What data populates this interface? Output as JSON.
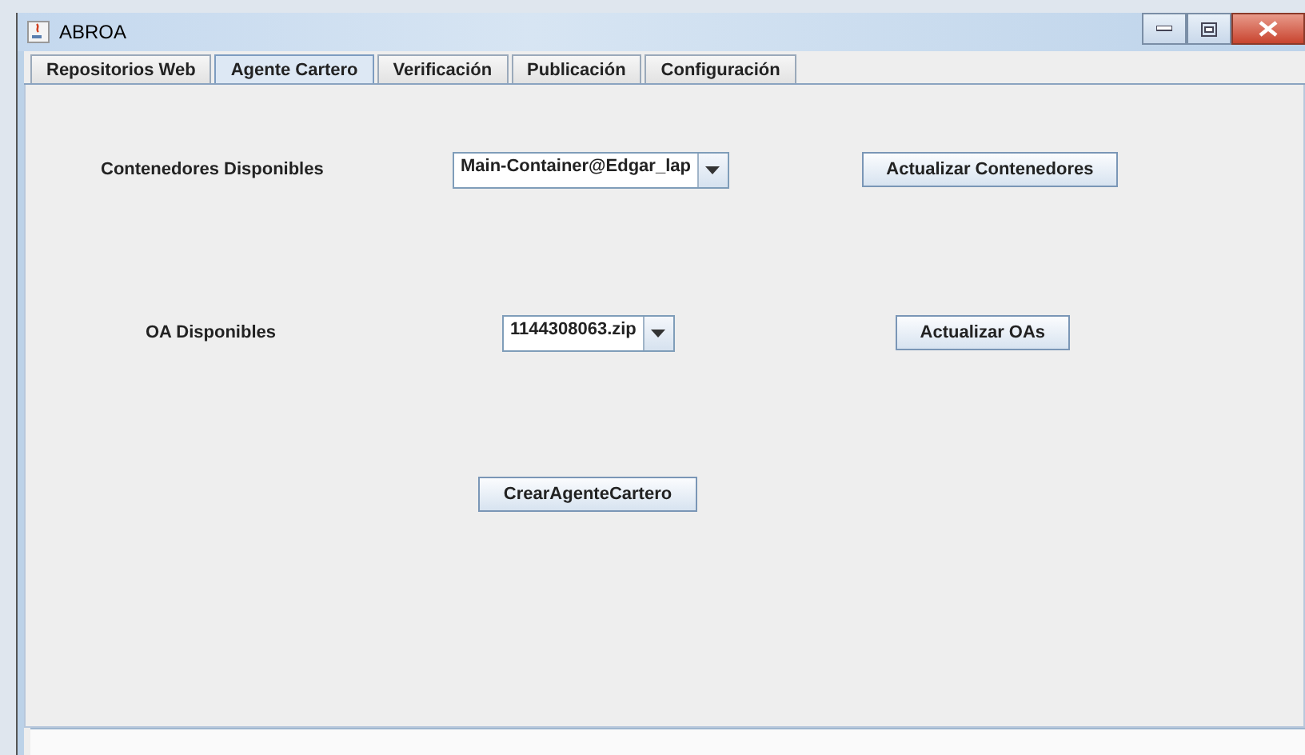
{
  "window": {
    "title": "ABROA"
  },
  "tabs": [
    {
      "label": "Repositorios Web",
      "selected": false
    },
    {
      "label": "Agente Cartero",
      "selected": true
    },
    {
      "label": "Verificación",
      "selected": false
    },
    {
      "label": "Publicación",
      "selected": false
    },
    {
      "label": "Configuración",
      "selected": false
    }
  ],
  "rows": [
    {
      "label": "Contenedores Disponibles",
      "combo": "Main-Container@Edgar_lap",
      "button": "Actualizar Contenedores"
    },
    {
      "label": "OA Disponibles",
      "combo": "1144308063.zip",
      "button": "Actualizar OAs"
    }
  ],
  "create_button": "CrearAgenteCartero"
}
